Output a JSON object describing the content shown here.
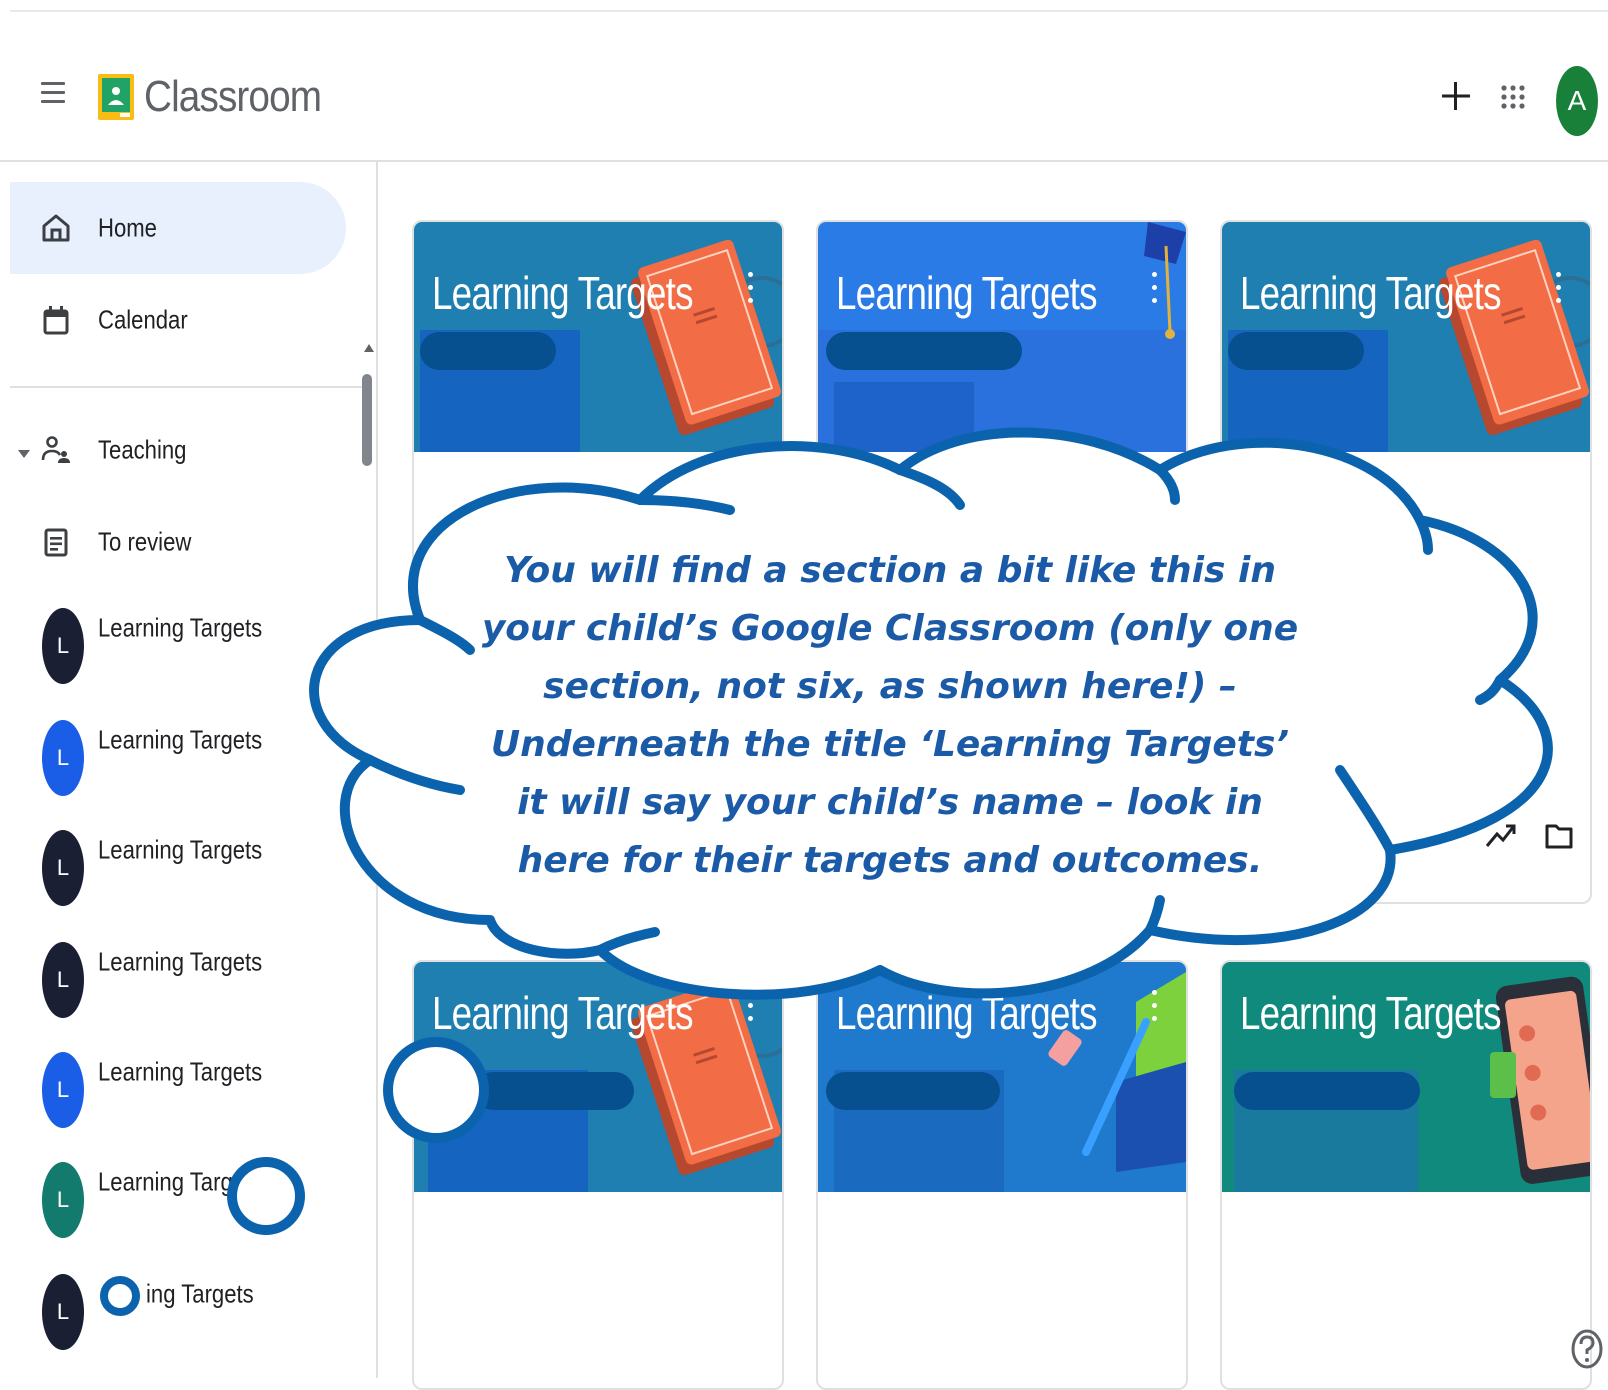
{
  "app": {
    "title": "Classroom",
    "avatar_letter": "A"
  },
  "header": {
    "menu_icon": "hamburger-menu-icon",
    "add_icon": "plus-icon",
    "apps_icon": "apps-grid-icon"
  },
  "sidebar": {
    "home": "Home",
    "calendar": "Calendar",
    "teaching": "Teaching",
    "to_review": "To review",
    "classes": [
      {
        "letter": "L",
        "label": "Learning Targets",
        "color": "#1a1f33"
      },
      {
        "letter": "L",
        "label": "Learning Targets",
        "color": "#1a5ee8"
      },
      {
        "letter": "L",
        "label": "Learning Targets",
        "color": "#1a1f33"
      },
      {
        "letter": "L",
        "label": "Learning Targets",
        "color": "#1a1f33"
      },
      {
        "letter": "L",
        "label": "Learning Targets",
        "color": "#1a5ee8"
      },
      {
        "letter": "L",
        "label": "Learning Target",
        "color": "#137a6e"
      },
      {
        "letter": "L",
        "label": "ing Targets",
        "color": "#1a1f33"
      }
    ]
  },
  "cards": [
    {
      "title": "Learning Targets",
      "theme": "book",
      "color": "#1f7fb0"
    },
    {
      "title": "Learning Targets",
      "theme": "graduation",
      "color": "#2b73e8"
    },
    {
      "title": "Learning Targets",
      "theme": "book",
      "color": "#1f7fb0"
    },
    {
      "title": "Learning Targets",
      "theme": "book",
      "color": "#1f7fb0"
    },
    {
      "title": "Learning Targets",
      "theme": "pencil",
      "color": "#1f79cc"
    },
    {
      "title": "Learning Targets",
      "theme": "phone",
      "color": "#0f8a7c"
    }
  ],
  "callout": "You will find a section a bit like this in your child’s Google Classroom (only one section, not six, as shown here!) – Underneath the title ‘Learning Targets’ it will say your child’s name – look in here for their targets and outcomes.",
  "colors": {
    "cloud_outline": "#0b63ad",
    "callout_text": "#1b5aa6",
    "avatar_bg": "#188038"
  }
}
